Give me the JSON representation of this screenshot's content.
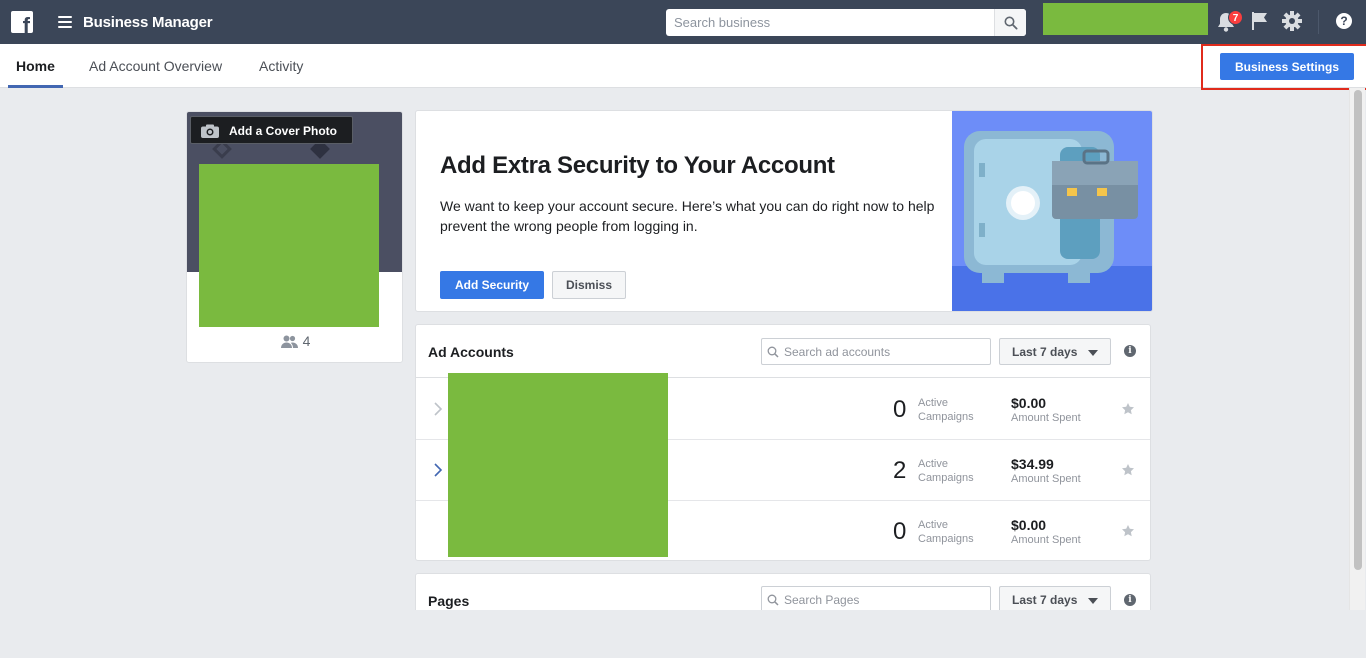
{
  "topbar": {
    "app_title": "Business Manager",
    "search_placeholder": "Search business",
    "notification_count": "7",
    "help_glyph": "?",
    "logo_glyph": "f"
  },
  "subnav": {
    "tabs": [
      {
        "label": "Home",
        "active": true
      },
      {
        "label": "Ad Account Overview",
        "active": false
      },
      {
        "label": "Activity",
        "active": false
      }
    ],
    "business_settings_label": "Business Settings"
  },
  "profile": {
    "cover_button_label": "Add a Cover Photo",
    "member_count": "4"
  },
  "security": {
    "title": "Add Extra Security to Your Account",
    "description": "We want to keep your account secure. Here’s what you can do right now to help prevent the wrong people from logging in.",
    "primary_label": "Add Security",
    "secondary_label": "Dismiss"
  },
  "ad_accounts": {
    "title": "Ad Accounts",
    "search_placeholder": "Search ad accounts",
    "date_range": "Last 7 days",
    "campaigns_label_1": "Active",
    "campaigns_label_2": "Campaigns",
    "amount_label": "Amount Spent",
    "rows": [
      {
        "campaigns": "0",
        "amount": "$0.00"
      },
      {
        "campaigns": "2",
        "amount": "$34.99"
      },
      {
        "campaigns": "0",
        "amount": "$0.00"
      }
    ]
  },
  "pages": {
    "title": "Pages",
    "search_placeholder": "Search Pages",
    "date_range": "Last 7 days"
  },
  "colors": {
    "topbar": "#3b4658",
    "primary_button": "#3578e5",
    "redacted": "#7aba3f",
    "highlight": "#e02b1c",
    "badge": "#fa3e3e"
  },
  "icons": [
    "facebook-logo-icon",
    "hamburger-icon",
    "search-icon",
    "bell-icon",
    "flag-icon",
    "gear-icon",
    "help-icon",
    "camera-icon",
    "people-icon",
    "chevron-right-icon",
    "star-icon",
    "info-icon",
    "caret-down-icon"
  ]
}
